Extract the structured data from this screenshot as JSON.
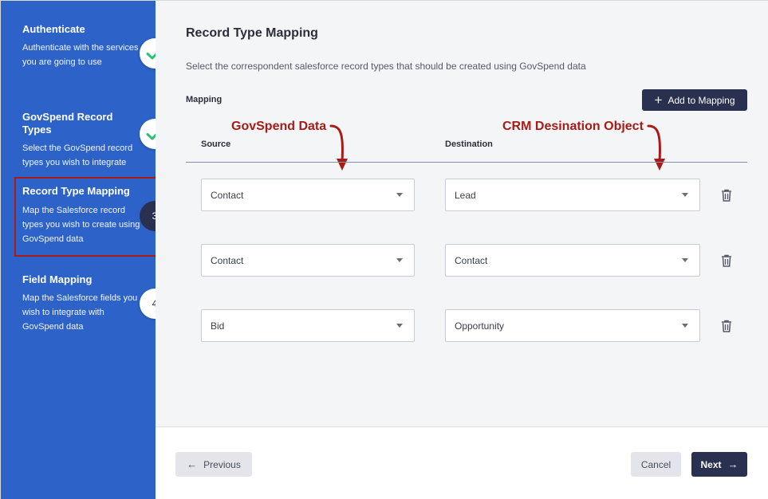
{
  "sidebar": {
    "steps": [
      {
        "title": "Authenticate",
        "description": "Authenticate with the services you are going to use",
        "status": "complete",
        "badge_icon": "check-icon"
      },
      {
        "title": "GovSpend Record Types",
        "description": "Select the GovSpend record types you wish to integrate",
        "status": "complete",
        "badge_icon": "check-icon"
      },
      {
        "title": "Record Type Mapping",
        "description": "Map the Salesforce record types you wish to create using GovSpend data",
        "status": "current",
        "badge_number": "3"
      },
      {
        "title": "Field Mapping",
        "description": "Map the Salesforce fields you wish to integrate with GovSpend data",
        "status": "upcoming",
        "badge_number": "4"
      }
    ]
  },
  "main": {
    "title": "Record Type Mapping",
    "subtitle": "Select the correspondent salesforce record types that should be created using GovSpend data",
    "mapping_label": "Mapping",
    "add_button_label": "Add to Mapping",
    "columns": {
      "source": "Source",
      "destination": "Destination"
    },
    "annotations": {
      "source": "GovSpend Data",
      "destination": "CRM Desination Object"
    },
    "rows": [
      {
        "source": "Contact",
        "destination": "Lead"
      },
      {
        "source": "Contact",
        "destination": "Contact"
      },
      {
        "source": "Bid",
        "destination": "Opportunity"
      }
    ]
  },
  "footer": {
    "previous_label": "Previous",
    "cancel_label": "Cancel",
    "next_label": "Next"
  },
  "colors": {
    "sidebar": "#2d63c8",
    "primary": "#2a3150",
    "annotation": "#a81b17",
    "check": "#2bbf7a",
    "background": "#f4f5f7"
  }
}
